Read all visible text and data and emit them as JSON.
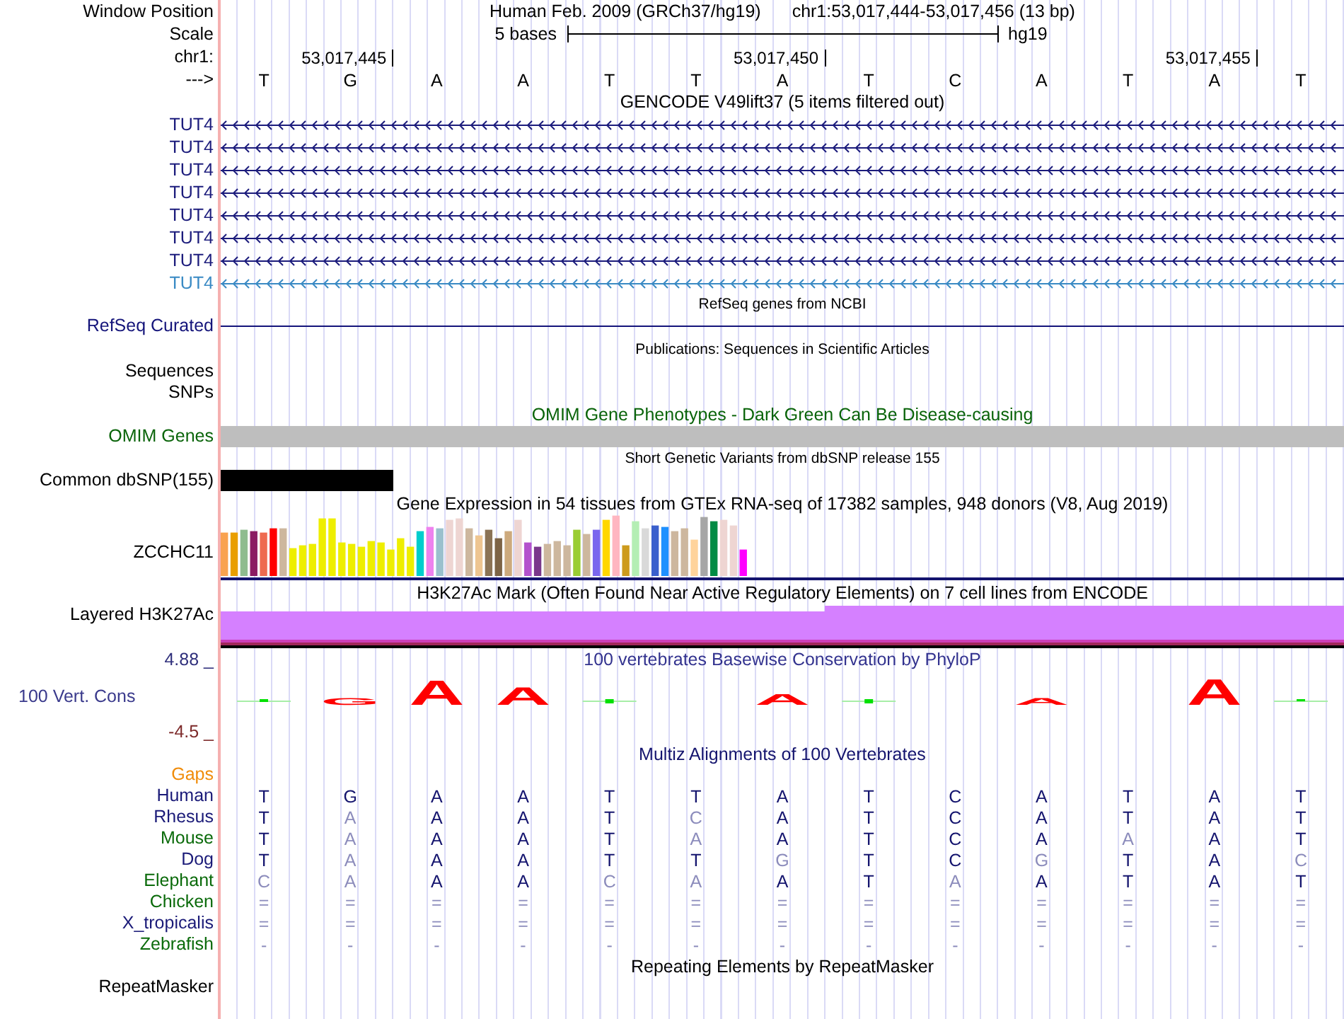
{
  "ruler": {
    "position_label": "Window Position",
    "assembly": "Human Feb. 2009 (GRCh37/hg19)",
    "range": "chr1:53,017,444-53,017,456 (13 bp)",
    "scale_label": "Scale",
    "scale_text": "5 bases",
    "scale_assembly": "hg19",
    "chrom_label": "chr1:",
    "strand_label": "--->",
    "positions": [
      {
        "base": "T"
      },
      {
        "base": "G",
        "coordinate": "53,017,445"
      },
      {
        "base": "A"
      },
      {
        "base": "A"
      },
      {
        "base": "T"
      },
      {
        "base": "T"
      },
      {
        "base": "A",
        "coordinate": "53,017,450"
      },
      {
        "base": "T"
      },
      {
        "base": "C"
      },
      {
        "base": "A"
      },
      {
        "base": "T"
      },
      {
        "base": "A",
        "coordinate": "53,017,455"
      },
      {
        "base": "T"
      }
    ]
  },
  "tracks": [
    {
      "kind": "gene-models",
      "title": "GENCODE V49lift37 (5 items filtered out)",
      "items": [
        {
          "label": "TUT4",
          "color": "#1c1c7c"
        },
        {
          "label": "TUT4",
          "color": "#1c1c7c"
        },
        {
          "label": "TUT4",
          "color": "#1c1c7c"
        },
        {
          "label": "TUT4",
          "color": "#1c1c7c"
        },
        {
          "label": "TUT4",
          "color": "#1c1c7c"
        },
        {
          "label": "TUT4",
          "color": "#1c1c7c"
        },
        {
          "label": "TUT4",
          "color": "#1c1c7c"
        },
        {
          "label": "TUT4",
          "color": "#3a8ac4"
        }
      ]
    },
    {
      "kind": "refseq",
      "title": "RefSeq genes from NCBI",
      "label": "RefSeq Curated"
    },
    {
      "kind": "publications",
      "title": "Publications: Sequences in Scientific Articles",
      "labels": [
        "Sequences",
        "SNPs"
      ]
    },
    {
      "kind": "phenotypes",
      "title": "OMIM Gene Phenotypes - Dark Green Can Be Disease-causing",
      "label": "OMIM Genes"
    },
    {
      "kind": "variants",
      "title": "Short Genetic Variants from dbSNP release 155",
      "label": "Common dbSNP(155)"
    },
    {
      "kind": "expression",
      "title": "Gene Expression in 54 tissues from GTEx RNA-seq of 17382 samples, 948 donors (V8, Aug 2019)",
      "label": "ZCCHC11"
    },
    {
      "kind": "histone",
      "title": "H3K27Ac Mark (Often Found Near Active Regulatory Elements) on 7 cell lines from ENCODE",
      "label": "Layered H3K27Ac"
    },
    {
      "kind": "conservation",
      "title": "100 vertebrates Basewise Conservation by PhyloP",
      "label": "100 Vert. Cons",
      "scale_max": "4.88 _",
      "scale_min": "-4.5 _",
      "marks": [
        {
          "kind": "dip"
        },
        {
          "kind": "letter",
          "base": "G"
        },
        {
          "kind": "letter",
          "base": "A"
        },
        {
          "kind": "letter",
          "base": "A"
        },
        {
          "kind": "dip"
        },
        {
          "kind": "none"
        },
        {
          "kind": "letter",
          "base": "A"
        },
        {
          "kind": "dip"
        },
        {
          "kind": "none"
        },
        {
          "kind": "letter",
          "base": "A"
        },
        {
          "kind": "none"
        },
        {
          "kind": "letter",
          "base": "A"
        },
        {
          "kind": "dip"
        }
      ]
    },
    {
      "kind": "alignment",
      "title": "Multiz Alignments of 100 Vertebrates",
      "gaps_label": "Gaps",
      "species": [
        {
          "name": "Human",
          "color": "#1a1a78",
          "bases": [
            {
              "base": "T",
              "matches": true
            },
            {
              "base": "G",
              "matches": true
            },
            {
              "base": "A",
              "matches": true
            },
            {
              "base": "A",
              "matches": true
            },
            {
              "base": "T",
              "matches": true
            },
            {
              "base": "T",
              "matches": true
            },
            {
              "base": "A",
              "matches": true
            },
            {
              "base": "T",
              "matches": true
            },
            {
              "base": "C",
              "matches": true
            },
            {
              "base": "A",
              "matches": true
            },
            {
              "base": "T",
              "matches": true
            },
            {
              "base": "A",
              "matches": true
            },
            {
              "base": "T",
              "matches": true
            }
          ]
        },
        {
          "name": "Rhesus",
          "color": "#1a1a78",
          "bases": [
            {
              "base": "T",
              "matches": true
            },
            {
              "base": "A",
              "matches": false
            },
            {
              "base": "A",
              "matches": true
            },
            {
              "base": "A",
              "matches": true
            },
            {
              "base": "T",
              "matches": true
            },
            {
              "base": "C",
              "matches": false
            },
            {
              "base": "A",
              "matches": true
            },
            {
              "base": "T",
              "matches": true
            },
            {
              "base": "C",
              "matches": true
            },
            {
              "base": "A",
              "matches": true
            },
            {
              "base": "T",
              "matches": true
            },
            {
              "base": "A",
              "matches": true
            },
            {
              "base": "T",
              "matches": true
            }
          ]
        },
        {
          "name": "Mouse",
          "color": "#0a6a0a",
          "bases": [
            {
              "base": "T",
              "matches": true
            },
            {
              "base": "A",
              "matches": false
            },
            {
              "base": "A",
              "matches": true
            },
            {
              "base": "A",
              "matches": true
            },
            {
              "base": "T",
              "matches": true
            },
            {
              "base": "A",
              "matches": false
            },
            {
              "base": "A",
              "matches": true
            },
            {
              "base": "T",
              "matches": true
            },
            {
              "base": "C",
              "matches": true
            },
            {
              "base": "A",
              "matches": true
            },
            {
              "base": "A",
              "matches": false
            },
            {
              "base": "A",
              "matches": true
            },
            {
              "base": "T",
              "matches": true
            }
          ]
        },
        {
          "name": "Dog",
          "color": "#1a1a78",
          "bases": [
            {
              "base": "T",
              "matches": true
            },
            {
              "base": "A",
              "matches": false
            },
            {
              "base": "A",
              "matches": true
            },
            {
              "base": "A",
              "matches": true
            },
            {
              "base": "T",
              "matches": true
            },
            {
              "base": "T",
              "matches": true
            },
            {
              "base": "G",
              "matches": false
            },
            {
              "base": "T",
              "matches": true
            },
            {
              "base": "C",
              "matches": true
            },
            {
              "base": "G",
              "matches": false
            },
            {
              "base": "T",
              "matches": true
            },
            {
              "base": "A",
              "matches": true
            },
            {
              "base": "C",
              "matches": false
            }
          ]
        },
        {
          "name": "Elephant",
          "color": "#0a6a0a",
          "bases": [
            {
              "base": "C",
              "matches": false
            },
            {
              "base": "A",
              "matches": false
            },
            {
              "base": "A",
              "matches": true
            },
            {
              "base": "A",
              "matches": true
            },
            {
              "base": "C",
              "matches": false
            },
            {
              "base": "A",
              "matches": false
            },
            {
              "base": "A",
              "matches": true
            },
            {
              "base": "T",
              "matches": true
            },
            {
              "base": "A",
              "matches": false
            },
            {
              "base": "A",
              "matches": true
            },
            {
              "base": "T",
              "matches": true
            },
            {
              "base": "A",
              "matches": true
            },
            {
              "base": "T",
              "matches": true
            }
          ]
        },
        {
          "name": "Chicken",
          "color": "#0a6a0a",
          "bases": [
            {
              "base": "=",
              "matches": false
            },
            {
              "base": "=",
              "matches": false
            },
            {
              "base": "=",
              "matches": false
            },
            {
              "base": "=",
              "matches": false
            },
            {
              "base": "=",
              "matches": false
            },
            {
              "base": "=",
              "matches": false
            },
            {
              "base": "=",
              "matches": false
            },
            {
              "base": "=",
              "matches": false
            },
            {
              "base": "=",
              "matches": false
            },
            {
              "base": "=",
              "matches": false
            },
            {
              "base": "=",
              "matches": false
            },
            {
              "base": "=",
              "matches": false
            },
            {
              "base": "=",
              "matches": false
            }
          ]
        },
        {
          "name": "X_tropicalis",
          "color": "#1a1a78",
          "bases": [
            {
              "base": "=",
              "matches": false
            },
            {
              "base": "=",
              "matches": false
            },
            {
              "base": "=",
              "matches": false
            },
            {
              "base": "=",
              "matches": false
            },
            {
              "base": "=",
              "matches": false
            },
            {
              "base": "=",
              "matches": false
            },
            {
              "base": "=",
              "matches": false
            },
            {
              "base": "=",
              "matches": false
            },
            {
              "base": "=",
              "matches": false
            },
            {
              "base": "=",
              "matches": false
            },
            {
              "base": "=",
              "matches": false
            },
            {
              "base": "=",
              "matches": false
            },
            {
              "base": "=",
              "matches": false
            }
          ]
        },
        {
          "name": "Zebrafish",
          "color": "#0a6a0a",
          "bases": [
            {
              "base": "-",
              "matches": false
            },
            {
              "base": "-",
              "matches": false
            },
            {
              "base": "-",
              "matches": false
            },
            {
              "base": "-",
              "matches": false
            },
            {
              "base": "-",
              "matches": false
            },
            {
              "base": "-",
              "matches": false
            },
            {
              "base": "-",
              "matches": false
            },
            {
              "base": "-",
              "matches": false
            },
            {
              "base": "-",
              "matches": false
            },
            {
              "base": "-",
              "matches": false
            },
            {
              "base": "-",
              "matches": false
            },
            {
              "base": "-",
              "matches": false
            },
            {
              "base": "-",
              "matches": false
            }
          ]
        }
      ]
    },
    {
      "kind": "repeats",
      "title": "Repeating Elements by RepeatMasker",
      "labels": [
        "RepeatMasker"
      ]
    }
  ]
}
